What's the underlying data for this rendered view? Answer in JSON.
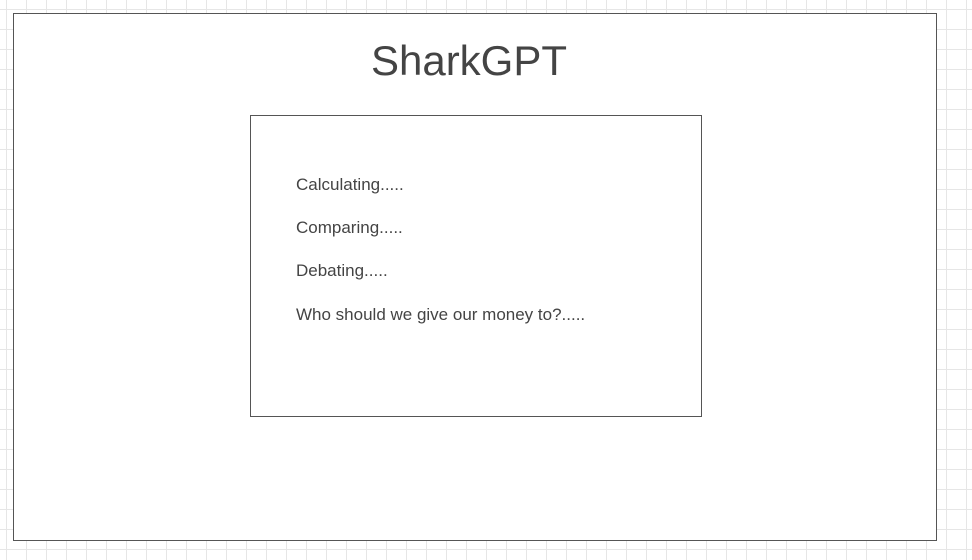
{
  "app": {
    "title": "SharkGPT"
  },
  "panel": {
    "lines": [
      "Calculating.....",
      "Comparing.....",
      "Debating.....",
      "Who should we give our money to?....."
    ]
  },
  "colors": {
    "text": "#444444",
    "border": "#555555",
    "grid": "#e6e6e6",
    "background": "#ffffff"
  }
}
